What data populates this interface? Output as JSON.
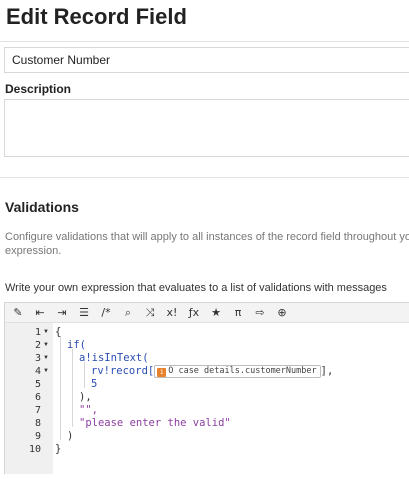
{
  "page": {
    "title": "Edit Record Field",
    "name_value": "Customer Number",
    "description_label": "Description",
    "description_value": ""
  },
  "validations": {
    "heading": "Validations",
    "description_line1": "Configure validations that will apply to all instances of the record field throughout you",
    "description_line2": "expression.",
    "expression_label": "Write your own expression that evaluates to a list of validations with messages"
  },
  "editor": {
    "toolbar": [
      {
        "name": "magic-wand-icon",
        "glyph": "✎"
      },
      {
        "name": "outdent-icon",
        "glyph": "⇤"
      },
      {
        "name": "indent-icon",
        "glyph": "⇥"
      },
      {
        "name": "list-icon",
        "glyph": "☰"
      },
      {
        "name": "comment-icon",
        "glyph": "/*"
      },
      {
        "name": "search-icon",
        "glyph": "⌕"
      },
      {
        "name": "shuffle-icon",
        "glyph": "⤨"
      },
      {
        "name": "exclamation-icon",
        "glyph": "x!"
      },
      {
        "name": "function-icon",
        "glyph": "ƒx"
      },
      {
        "name": "star-icon",
        "glyph": "★"
      },
      {
        "name": "pi-icon",
        "glyph": "π"
      },
      {
        "name": "export-icon",
        "glyph": "⇨"
      },
      {
        "name": "globe-icon",
        "glyph": "⊕"
      }
    ],
    "line_numbers": [
      "1",
      "2",
      "3",
      "4",
      "5",
      "6",
      "7",
      "8",
      "9",
      "10"
    ],
    "code": {
      "l1": "{",
      "l2": "if(",
      "l3": "a!isInText(",
      "l4_pre": "rv!record[",
      "l4_chip_icon": "1",
      "l4_chip": "O case details.customerNumber",
      "l4_post": "],",
      "l5": "5",
      "l6": "),",
      "l7": "\"\",",
      "l8": "\"please enter the valid\"",
      "l9": ")",
      "l10": "}"
    }
  }
}
